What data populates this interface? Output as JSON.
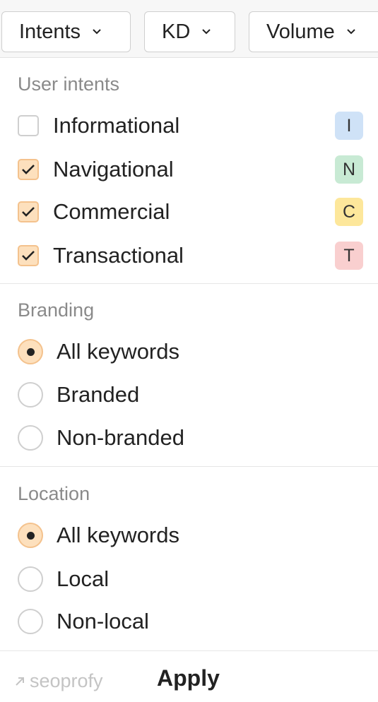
{
  "filters": {
    "intents_label": "Intents",
    "kd_label": "KD",
    "volume_label": "Volume"
  },
  "user_intents": {
    "title": "User intents",
    "items": [
      {
        "label": "Informational",
        "checked": false,
        "badge": "I",
        "badge_color": "#cfe2f7"
      },
      {
        "label": "Navigational",
        "checked": true,
        "badge": "N",
        "badge_color": "#c8ead4"
      },
      {
        "label": "Commercial",
        "checked": true,
        "badge": "C",
        "badge_color": "#fde79b"
      },
      {
        "label": "Transactional",
        "checked": true,
        "badge": "T",
        "badge_color": "#f9cfcf"
      }
    ]
  },
  "branding": {
    "title": "Branding",
    "options": [
      {
        "label": "All keywords",
        "selected": true
      },
      {
        "label": "Branded",
        "selected": false
      },
      {
        "label": "Non-branded",
        "selected": false
      }
    ]
  },
  "location": {
    "title": "Location",
    "options": [
      {
        "label": "All keywords",
        "selected": true
      },
      {
        "label": "Local",
        "selected": false
      },
      {
        "label": "Non-local",
        "selected": false
      }
    ]
  },
  "footer": {
    "watermark": "seoprofy",
    "apply_label": "Apply"
  },
  "colors": {
    "checked_fill": "#fde0bd",
    "checked_border": "#f4c28d"
  },
  "icons": {
    "chevron": "chevron-down-icon",
    "check": "check-icon",
    "watermark_arrow": "arrow-up-right-icon"
  }
}
